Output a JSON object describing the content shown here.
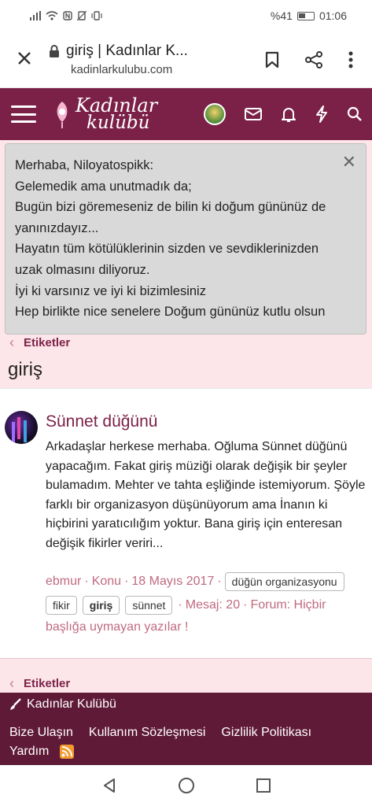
{
  "status": {
    "battery_percent": "%41",
    "time": "01:06"
  },
  "browser": {
    "title": "giriş | Kadınlar K...",
    "domain": "kadinlarkulubu.com"
  },
  "site": {
    "logo_line1": "Kadınlar",
    "logo_line2": "kulübü"
  },
  "notice": {
    "lines": [
      "Merhaba, Niloyatospikk:",
      "Gelemedik ama unutmadık da;",
      "Bugün bizi göremeseniz de bilin ki doğum gününüz de",
      "yanınızdayız...",
      "Hayatın tüm kötülüklerinin sizden ve sevdiklerinizden",
      "uzak olmasını diliyoruz.",
      "İyi ki varsınız ve iyi ki bizimlesiniz",
      "Hep birlikte nice senelere Doğum gününüz kutlu olsun"
    ],
    "close_label": "✕"
  },
  "breadcrumb": {
    "label": "Etiketler"
  },
  "page": {
    "title": "giriş"
  },
  "thread": {
    "title": "Sünnet düğünü",
    "body": "Arkadaşlar herkese merhaba. Oğluma Sünnet düğünü yapacağım. Fakat giriş müziği olarak değişik bir şeyler bulamadım. Mehter ve tahta eşliğinde istemiyorum. Şöyle farklı bir organizasyon düşünüyorum ama İnanın ki hiçbirini yaratıcılığım yoktur. Bana giriş için enteresan değişik fikirler veriri...",
    "author": "ebmur",
    "type": "Konu",
    "date": "18 Mayıs 2017",
    "tags": [
      "düğün organizasyonu",
      "fikir",
      "giriş",
      "sünnet"
    ],
    "replies": "Mesaj: 20",
    "forum_prefix": "Forum: Hiçbir",
    "forum_suffix": "başlığa uymayan yazılar !"
  },
  "footer": {
    "brand": "Kadınlar Kulübü",
    "links": [
      "Bize Ulaşın",
      "Kullanım Sözleşmesi",
      "Gizlilik Politikası"
    ],
    "help": "Yardım"
  },
  "colors": {
    "brand": "#7b2147",
    "footer": "#5f1a37",
    "notice_bg": "#d9d9d9",
    "pink_bg": "#fde6ea"
  }
}
